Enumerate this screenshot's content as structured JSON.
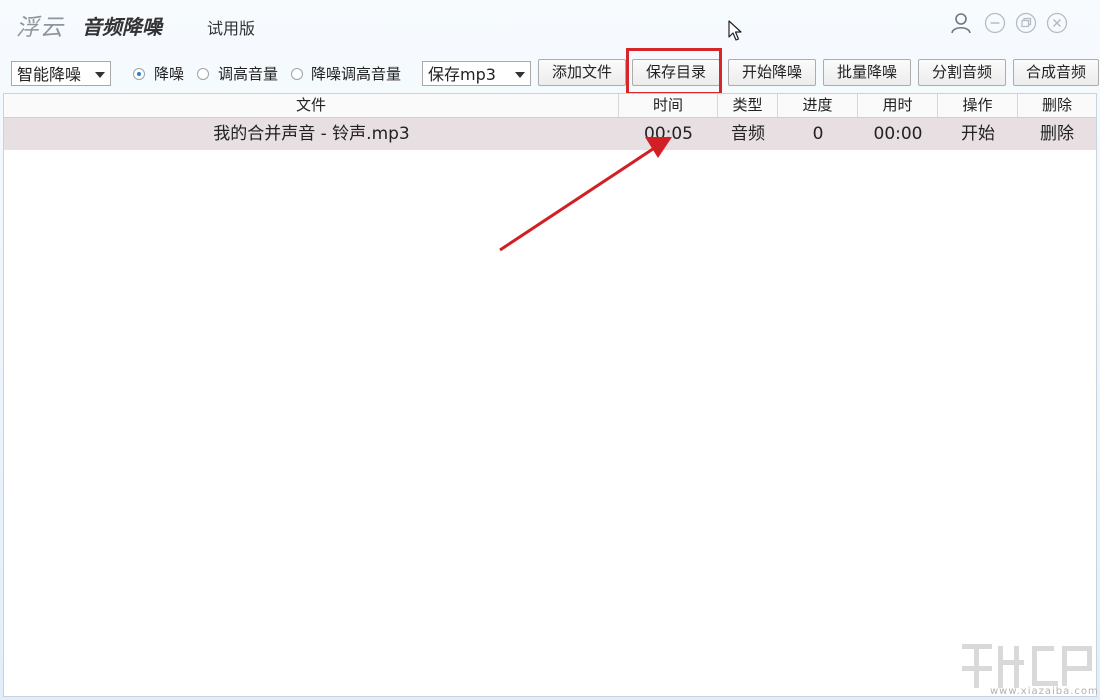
{
  "title": {
    "brand": "浮云",
    "app_name": "音频降噪",
    "edition": "试用版"
  },
  "window_controls": [
    "user-icon",
    "minimize-icon",
    "restore-icon",
    "close-icon"
  ],
  "toolbar": {
    "mode_select": "智能降噪",
    "radios": [
      {
        "label": "降噪",
        "checked": true
      },
      {
        "label": "调高音量",
        "checked": false
      },
      {
        "label": "降噪调高音量",
        "checked": false
      }
    ],
    "format_select": "保存mp3",
    "buttons": {
      "add_file": "添加文件",
      "save_dir": "保存目录",
      "start_denoise": "开始降噪",
      "batch_denoise": "批量降噪",
      "split_audio": "分割音频",
      "merge_audio": "合成音频"
    }
  },
  "table": {
    "headers": {
      "file": "文件",
      "time": "时间",
      "type": "类型",
      "progress": "进度",
      "elapsed": "用时",
      "action": "操作",
      "delete": "删除"
    },
    "rows": [
      {
        "file": "我的合并声音 - 铃声.mp3",
        "time": "00:05",
        "type": "音频",
        "progress": "0",
        "elapsed": "00:00",
        "action": "开始",
        "delete": "删除"
      }
    ]
  },
  "watermark": {
    "text": "www.xiazaiba.com"
  },
  "colors": {
    "highlight": "#d6262a",
    "row_selected": "#e7dfe2",
    "radio_accent": "#2a7fd1"
  }
}
